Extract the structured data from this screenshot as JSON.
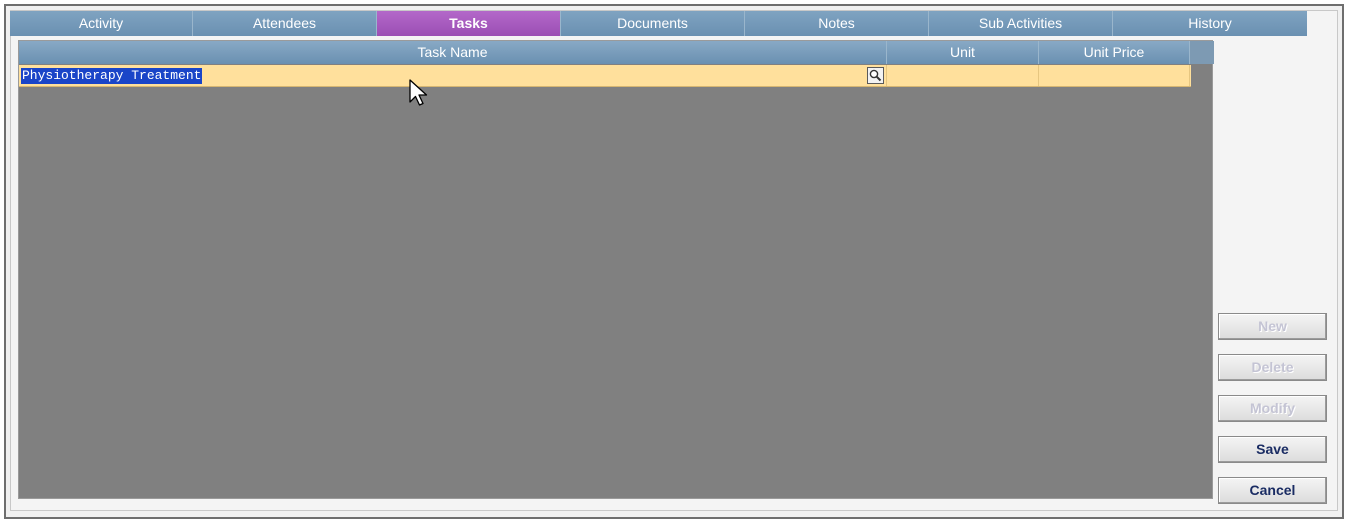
{
  "tabs": [
    {
      "label": "Activity",
      "active": false
    },
    {
      "label": "Attendees",
      "active": false
    },
    {
      "label": "Tasks",
      "active": true
    },
    {
      "label": "Documents",
      "active": false
    },
    {
      "label": "Notes",
      "active": false
    },
    {
      "label": "Sub Activities",
      "active": false
    },
    {
      "label": "History",
      "active": false
    }
  ],
  "grid": {
    "columns": [
      "Task Name",
      "Unit",
      "Unit Price"
    ],
    "rows": [
      {
        "task_name": "Physiotherapy Treatment",
        "unit": "",
        "unit_price": ""
      }
    ]
  },
  "buttons": {
    "new": {
      "label": "New",
      "enabled": false
    },
    "delete": {
      "label": "Delete",
      "enabled": false
    },
    "modify": {
      "label": "Modify",
      "enabled": false
    },
    "save": {
      "label": "Save",
      "enabled": true
    },
    "cancel": {
      "label": "Cancel",
      "enabled": true
    }
  },
  "colors": {
    "tab_bar": "#6f96b6",
    "tab_active": "#9b4fb4",
    "grid_background": "#808080",
    "selected_row": "#ffe09c",
    "text_selection": "#1a45c8"
  },
  "icons": {
    "lookup": "magnifier-icon",
    "cursor": "mouse-pointer-icon"
  }
}
